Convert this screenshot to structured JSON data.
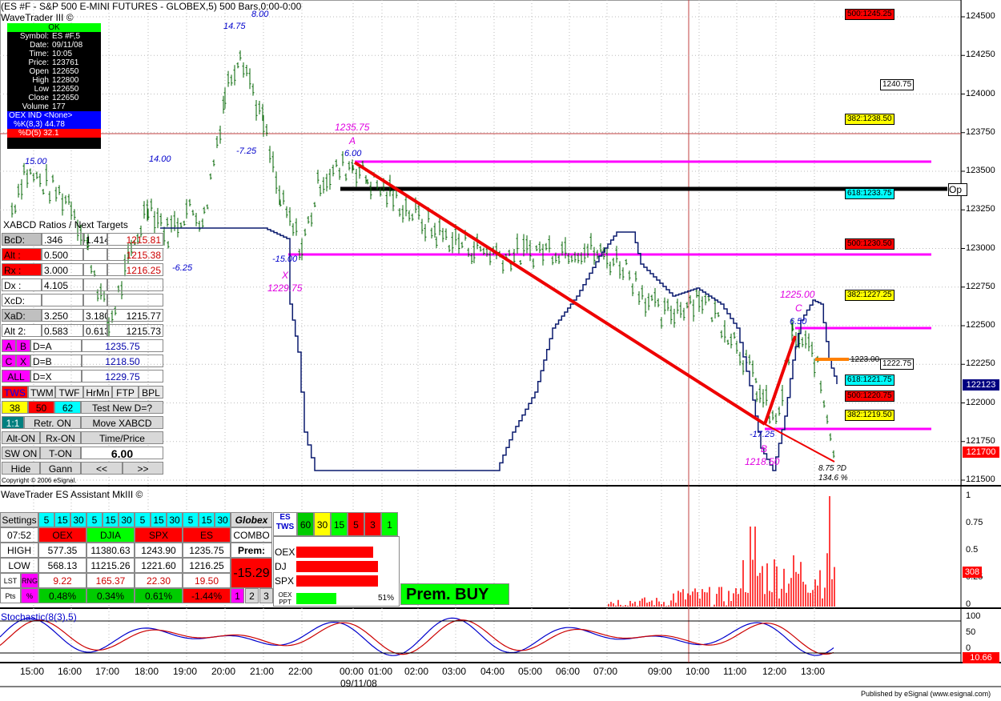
{
  "header": {
    "title": "(ES #F - S&P 500 E-MINI FUTURES - GLOBEX,5) 500 Bars,0:00-0:00",
    "app": "WaveTrader III ©"
  },
  "data_window": {
    "status": "OK",
    "rows": [
      {
        "k": "Symbol:",
        "v": "ES #F,5"
      },
      {
        "k": "Date:",
        "v": "09/11/08"
      },
      {
        "k": "Time:",
        "v": "10:05"
      },
      {
        "k": "Price:",
        "v": "123761"
      },
      {
        "k": "Open",
        "v": "122650"
      },
      {
        "k": "High",
        "v": "122800"
      },
      {
        "k": "Low",
        "v": "122650"
      },
      {
        "k": "Close",
        "v": "122650"
      },
      {
        "k": "Volume",
        "v": "177"
      }
    ],
    "oex_ind": "OEX IND <None>",
    "k_line": "%K(8,3) 44.78",
    "d_line": "%D(5) 32.1"
  },
  "price_axis": [
    "124500",
    "124250",
    "124000",
    "123750",
    "123500",
    "123250",
    "123000",
    "122750",
    "122500",
    "122250",
    "122000",
    "121750",
    "121500"
  ],
  "last_price": "122123",
  "last_price2": "121700",
  "fib_boxes": [
    {
      "label": "500:1245.25",
      "bg": "#ff0000",
      "fg": "#000"
    },
    {
      "label": "1240.75",
      "bg": "#ffffff",
      "fg": "#000"
    },
    {
      "label": "382:1238.50",
      "bg": "#ffff00",
      "fg": "#000"
    },
    {
      "label": "618:1233.75",
      "bg": "#00ffff",
      "fg": "#000"
    },
    {
      "label": "500:1230.50",
      "bg": "#ff0000",
      "fg": "#000"
    },
    {
      "label": "382:1227.25",
      "bg": "#ffff00",
      "fg": "#000"
    },
    {
      "label": "1222.75",
      "bg": "#ffffff",
      "fg": "#000"
    },
    {
      "label": "618:1221.75",
      "bg": "#00ffff",
      "fg": "#000"
    },
    {
      "label": "500:1220.75",
      "bg": "#ff0000",
      "fg": "#000"
    },
    {
      "label": "382:1219.50",
      "bg": "#ffff00",
      "fg": "#000"
    }
  ],
  "op_label": "Op",
  "annotations": {
    "a_label": "A",
    "a_price": "1235.75",
    "a_wave": "6.00",
    "x_label": "X",
    "x_price": "1229.75",
    "x_wave": "-15.00",
    "b_label": "B",
    "b_price": "1218.50",
    "b_wave": "-17.25",
    "c_label": "C",
    "c_price": "1225.00",
    "c_wave": "6.50",
    "w1": "15.00",
    "w2": "14.00",
    "w3": "14.75",
    "w4": "8.00",
    "w5": "-7.25",
    "w6": "-6.25",
    "d_note": "8.75 ?D",
    "d_pct": "134.6 %",
    "level_1223": "1223.00"
  },
  "xabcd": {
    "title": "XABCD Ratios / Next Targets",
    "rows": [
      {
        "a": "BcD:",
        "b": ".346",
        "c": "1.414:",
        "d": "1215.81"
      },
      {
        "a": "Alt  :",
        "b": "0.500",
        "c": "",
        "d": "1215.38"
      },
      {
        "a": "Rx  :",
        "b": "3.000",
        "c": "",
        "d": "1216.25"
      },
      {
        "a": "Dx  :",
        "b": "4.105",
        "c": "",
        "d": ""
      },
      {
        "a": "XcD:",
        "b": "",
        "c": "",
        "d": ""
      },
      {
        "a": "XaD:",
        "b": "3.250",
        "c": "3.180",
        "d": "1215.77"
      },
      {
        "a": "Alt 2:",
        "b": "0.583",
        "c": "0.613",
        "d": "1215.73"
      }
    ],
    "d_rows": [
      {
        "l1": "A",
        "l2": "B",
        "t": "D=A",
        "v": "1235.75"
      },
      {
        "l1": "C",
        "l2": "X",
        "t": "D=B",
        "v": "1218.50"
      },
      {
        "l1": "ALL",
        "l2": "",
        "t": "D=X",
        "v": "1229.75"
      }
    ],
    "tabs": [
      "TWS",
      "TWM",
      "TWF",
      "HrMn",
      "FTP",
      "BPL"
    ],
    "retr": [
      "38",
      "50",
      "62"
    ],
    "test_label": "Test New D=?",
    "btn_11": "1:1",
    "retr_on": "Retr. ON",
    "move": "Move XABCD",
    "alt_on": "Alt-ON",
    "rx_on": "Rx-ON",
    "time_price": "Time/Price",
    "sw_on": "SW ON",
    "t_on": "T-ON",
    "value": "6.00",
    "hide": "Hide",
    "gann": "Gann",
    "prev": "<<",
    "next": ">>"
  },
  "copyright": "Copyright © 2006 eSignal.",
  "assistant": {
    "title": "WaveTrader ES Assistant MkIII ©",
    "settings": "Settings",
    "intervals": [
      "5",
      "15",
      "30"
    ],
    "globex": "Globex",
    "time": "07:52",
    "cols": [
      "OEX",
      "DJIA",
      "SPX",
      "ES"
    ],
    "combo": "COMBO",
    "rows": [
      {
        "label": "HIGH",
        "vals": [
          "577.35",
          "11380.63",
          "1243.90",
          "1235.75"
        ]
      },
      {
        "label": "LOW",
        "vals": [
          "568.13",
          "11215.26",
          "1221.60",
          "1216.25"
        ]
      },
      {
        "label": "LST",
        "sub": "RNG",
        "vals": [
          "9.22",
          "165.37",
          "22.30",
          "19.50"
        ]
      },
      {
        "label": "Pts",
        "sub": "%",
        "vals": [
          "0.48%",
          "0.34%",
          "0.61%",
          "-1.44%"
        ]
      }
    ],
    "prem_label": "Prem:",
    "prem_value": "-15.29",
    "pages": [
      "1",
      "2",
      "3"
    ],
    "es_tws": "ES TWS",
    "tws_vals": [
      "60",
      "30",
      "15",
      "5",
      "3",
      "1"
    ],
    "bars": [
      {
        "k": "OEX"
      },
      {
        "k": "DJ"
      },
      {
        "k": "SPX"
      }
    ],
    "oex_ppt": "OEX PPT",
    "ppt_pct": "51%",
    "signal": "Prem. BUY"
  },
  "volume_axis": [
    "1",
    "0.75",
    "0.5",
    "0.25",
    "0"
  ],
  "volume_last": "308",
  "stoch": {
    "title": "Stochastic(8(3),5)",
    "axis": [
      "100",
      "50",
      "0"
    ],
    "last": "10.66"
  },
  "time_axis": [
    "15:00",
    "16:00",
    "17:00",
    "18:00",
    "19:00",
    "20:00",
    "21:00",
    "22:00",
    "00:00",
    "01:00",
    "02:00",
    "03:00",
    "04:00",
    "05:00",
    "06:00",
    "07:00",
    "09:00",
    "10:00",
    "11:00",
    "12:00",
    "13:00"
  ],
  "date_label": "09/11/08",
  "published": "Published by eSignal (www.esignal.com)",
  "chart_data": {
    "type": "line",
    "title": "(ES #F - S&P 500 E-MINI FUTURES - GLOBEX,5) 500 Bars,0:00-0:00",
    "ylim": [
      121500,
      124600
    ],
    "points": [
      [
        "15:00",
        123250
      ],
      [
        "15:30",
        123500
      ],
      [
        "16:00",
        123300
      ],
      [
        "16:30",
        123000
      ],
      [
        "17:00",
        122500
      ],
      [
        "17:30",
        122900
      ],
      [
        "18:00",
        123300
      ],
      [
        "18:30",
        123100
      ],
      [
        "19:00",
        123250
      ],
      [
        "19:30",
        123200
      ],
      [
        "20:00",
        124000
      ],
      [
        "20:30",
        124300
      ],
      [
        "21:00",
        123800
      ],
      [
        "21:30",
        123300
      ],
      [
        "22:00",
        123000
      ],
      [
        "22:30",
        123450
      ],
      [
        "00:00",
        123550
      ],
      [
        "00:45",
        123450
      ],
      [
        "01:30",
        123300
      ],
      [
        "02:30",
        123100
      ],
      [
        "03:30",
        123000
      ],
      [
        "04:30",
        122950
      ],
      [
        "05:30",
        123000
      ],
      [
        "06:30",
        123000
      ],
      [
        "07:30",
        122900
      ],
      [
        "09:00",
        122550
      ],
      [
        "10:00",
        122700
      ],
      [
        "11:00",
        122400
      ],
      [
        "11:30",
        122100
      ],
      [
        "12:00",
        121850
      ],
      [
        "12:30",
        122450
      ],
      [
        "13:00",
        122300
      ],
      [
        "13:15",
        121700
      ]
    ],
    "levels": [
      123575,
      123400,
      122975,
      122500,
      121850
    ],
    "stochastic": {
      "k": 44.78,
      "d": 32.1
    }
  }
}
